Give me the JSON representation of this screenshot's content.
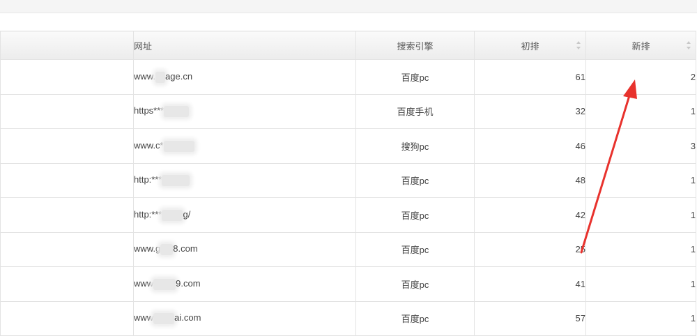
{
  "table": {
    "headers": {
      "url": "网址",
      "engine": "搜索引擎",
      "initial": "初排",
      "new": "新排"
    },
    "rows": [
      {
        "url_start": "www.",
        "url_end": "age.cn",
        "engine": "百度pc",
        "initial": "61",
        "new": "2"
      },
      {
        "url_start": "https***",
        "url_end": "",
        "engine": "百度手机",
        "initial": "32",
        "new": "1"
      },
      {
        "url_start": "www.c*",
        "url_end": "",
        "engine": "搜狗pc",
        "initial": "46",
        "new": "3"
      },
      {
        "url_start": "http:***",
        "url_end": "",
        "engine": "百度pc",
        "initial": "48",
        "new": "1"
      },
      {
        "url_start": "http:***",
        "url_end": "g/",
        "engine": "百度pc",
        "initial": "42",
        "new": "1"
      },
      {
        "url_start": "www.g",
        "url_end": "8.com",
        "engine": "百度pc",
        "initial": "25",
        "new": "1"
      },
      {
        "url_start": "www",
        "url_end": "9.com",
        "engine": "百度pc",
        "initial": "41",
        "new": "1"
      },
      {
        "url_start": "www",
        "url_end": "ai.com",
        "engine": "百度pc",
        "initial": "57",
        "new": "1"
      }
    ]
  },
  "annotation": {
    "arrow_color": "#e8322d"
  },
  "colors": {
    "header_bg": "#f0f0f0",
    "border": "#e3e3e3",
    "text": "#444444"
  }
}
